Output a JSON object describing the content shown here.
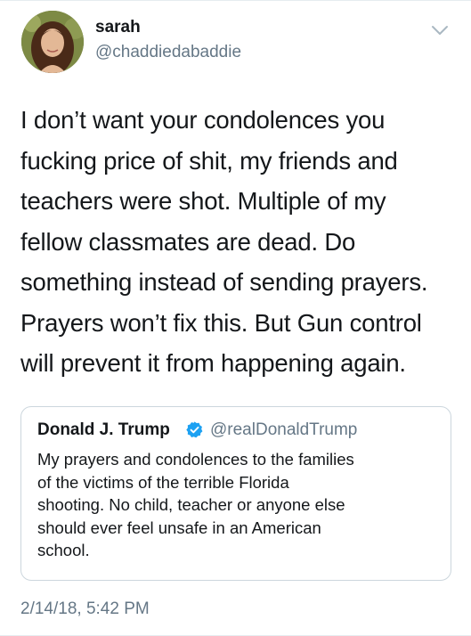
{
  "author": {
    "name": "sarah",
    "handle": "@chaddiedabaddie"
  },
  "icons": {
    "caret": "chevron-down-icon",
    "verified": "verified-badge-icon"
  },
  "tweet": {
    "text_lines": [
      "I don’t want your condolences you",
      "fucking price of shit, my friends and",
      "teachers were shot. Multiple of my",
      "fellow classmates are dead. Do",
      "something instead of sending prayers.",
      "Prayers won’t fix this. But Gun control",
      "will prevent it from happening again."
    ],
    "timestamp": "2/14/18, 5:42 PM"
  },
  "quoted_tweet": {
    "name": "Donald J. Trump",
    "handle": "@realDonaldTrump",
    "text_lines": [
      "My prayers and condolences to the families",
      "of the victims of the terrible Florida",
      "shooting. No child, teacher or anyone else",
      "should ever feel unsafe in an American",
      "school."
    ]
  },
  "colors": {
    "text": "#14171a",
    "secondary": "#657786",
    "verified": "#1da1f2",
    "border": "#ccd6dd"
  }
}
